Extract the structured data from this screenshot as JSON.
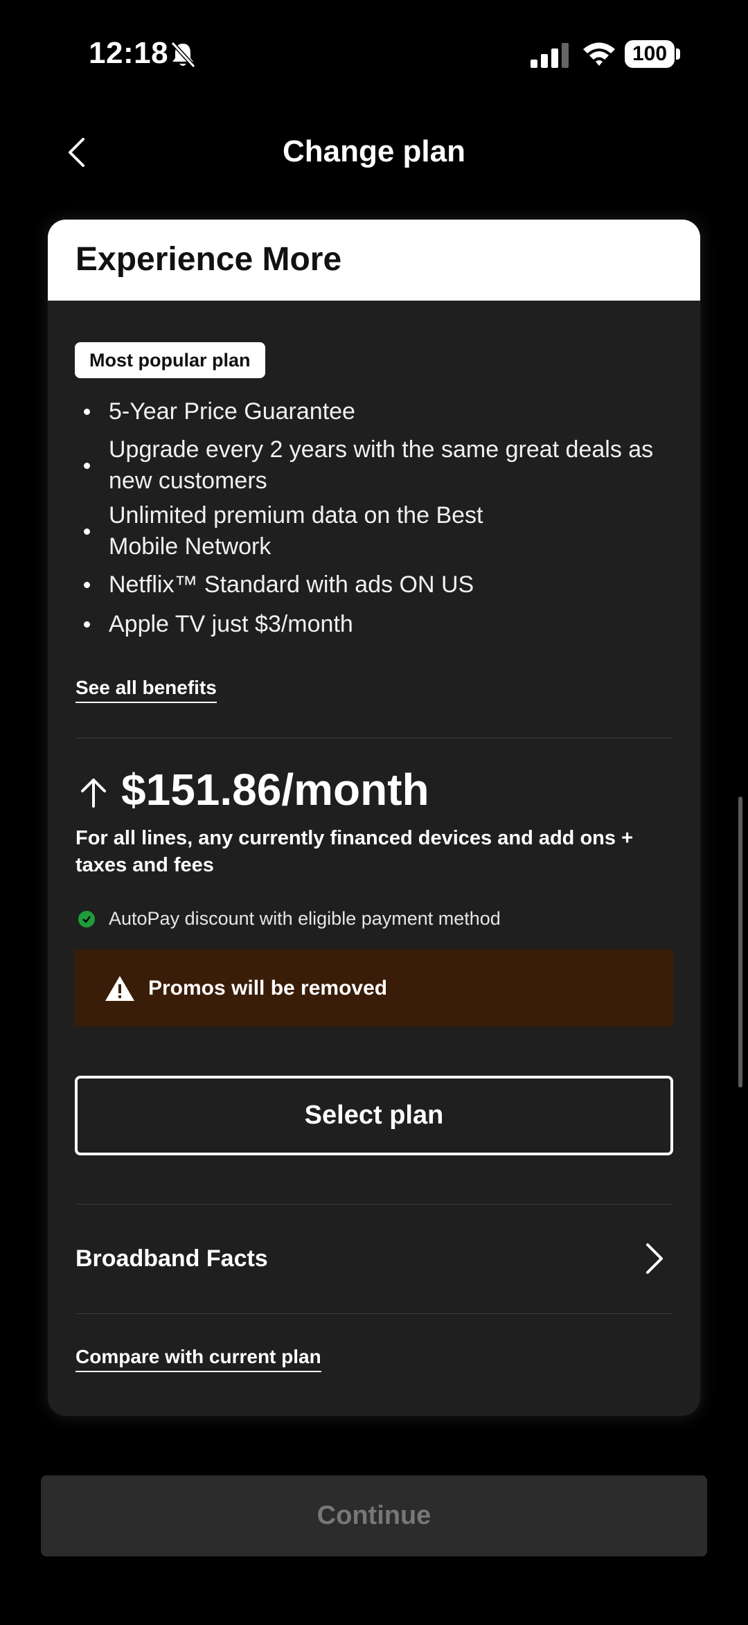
{
  "status_bar": {
    "time": "12:18",
    "battery": "100"
  },
  "nav": {
    "title": "Change plan"
  },
  "plan": {
    "name": "Experience More",
    "badge": "Most popular plan",
    "benefits": [
      "5-Year Price Guarantee",
      "Upgrade every 2 years with the same great deals as new customers",
      "Unlimited premium data on the Best Mobile Network",
      "Netflix™ Standard with ads ON US",
      "Apple TV just $3/month"
    ],
    "see_all_benefits": "See all benefits",
    "price": "$151.86/month",
    "price_note": "For all lines, any currently financed devices and add ons + taxes and fees",
    "autopay_note": "AutoPay discount with eligible payment method",
    "warning": "Promos will be removed",
    "select_button": "Select plan",
    "broadband_facts": "Broadband Facts",
    "compare_link": "Compare with current plan"
  },
  "footer": {
    "continue_button": "Continue"
  },
  "colors": {
    "background": "#000000",
    "card": "#1f1f1f",
    "warning_background": "#3a1d08",
    "autopay_check": "#1f9d3b",
    "disabled_button": "#2c2c2c"
  }
}
